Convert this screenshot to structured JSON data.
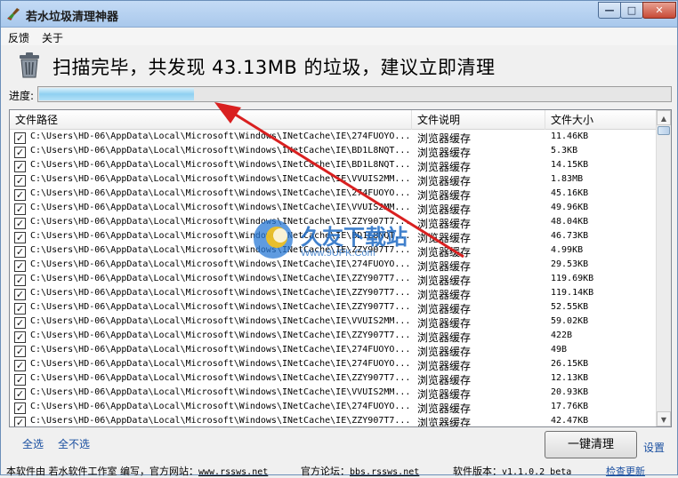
{
  "window": {
    "title": "若水垃圾清理神器",
    "controls": {
      "minimize": "—",
      "maximize": "□",
      "close": "✕"
    }
  },
  "menu": {
    "feedback": "反馈",
    "about": "关于"
  },
  "status": {
    "icon": "trash-can-icon",
    "text": "扫描完毕，共发现 43.13MB 的垃圾，建议立即清理"
  },
  "progress": {
    "label": "进度:",
    "fraction": 0.245
  },
  "table": {
    "columns": {
      "path": "文件路径",
      "description": "文件说明",
      "size": "文件大小"
    },
    "rows": [
      {
        "path": "C:\\Users\\HD-06\\AppData\\Local\\Microsoft\\Windows\\INetCache\\IE\\274FUOYO...",
        "desc": "浏览器缓存",
        "size": "11.46KB",
        "checked": true
      },
      {
        "path": "C:\\Users\\HD-06\\AppData\\Local\\Microsoft\\Windows\\INetCache\\IE\\BD1L8NQT...",
        "desc": "浏览器缓存",
        "size": "5.3KB",
        "checked": true
      },
      {
        "path": "C:\\Users\\HD-06\\AppData\\Local\\Microsoft\\Windows\\INetCache\\IE\\BD1L8NQT...",
        "desc": "浏览器缓存",
        "size": "14.15KB",
        "checked": true
      },
      {
        "path": "C:\\Users\\HD-06\\AppData\\Local\\Microsoft\\Windows\\INetCache\\IE\\VVUIS2MM...",
        "desc": "浏览器缓存",
        "size": "1.83MB",
        "checked": true
      },
      {
        "path": "C:\\Users\\HD-06\\AppData\\Local\\Microsoft\\Windows\\INetCache\\IE\\274FUOYO...",
        "desc": "浏览器缓存",
        "size": "45.16KB",
        "checked": true
      },
      {
        "path": "C:\\Users\\HD-06\\AppData\\Local\\Microsoft\\Windows\\INetCache\\IE\\VVUIS2MM...",
        "desc": "浏览器缓存",
        "size": "49.96KB",
        "checked": true
      },
      {
        "path": "C:\\Users\\HD-06\\AppData\\Local\\Microsoft\\Windows\\INetCache\\IE\\ZZY907T7...",
        "desc": "浏览器缓存",
        "size": "48.04KB",
        "checked": true
      },
      {
        "path": "C:\\Users\\HD-06\\AppData\\Local\\Microsoft\\Windows\\INetCache\\IE\\BD1L8NQT...",
        "desc": "浏览器缓存",
        "size": "46.73KB",
        "checked": true
      },
      {
        "path": "C:\\Users\\HD-06\\AppData\\Local\\Microsoft\\Windows\\INetCache\\IE\\ZZY907T7...",
        "desc": "浏览器缓存",
        "size": "4.99KB",
        "checked": true
      },
      {
        "path": "C:\\Users\\HD-06\\AppData\\Local\\Microsoft\\Windows\\INetCache\\IE\\274FUOYO...",
        "desc": "浏览器缓存",
        "size": "29.53KB",
        "checked": true
      },
      {
        "path": "C:\\Users\\HD-06\\AppData\\Local\\Microsoft\\Windows\\INetCache\\IE\\ZZY907T7...",
        "desc": "浏览器缓存",
        "size": "119.69KB",
        "checked": true
      },
      {
        "path": "C:\\Users\\HD-06\\AppData\\Local\\Microsoft\\Windows\\INetCache\\IE\\ZZY907T7...",
        "desc": "浏览器缓存",
        "size": "119.14KB",
        "checked": true
      },
      {
        "path": "C:\\Users\\HD-06\\AppData\\Local\\Microsoft\\Windows\\INetCache\\IE\\ZZY907T7...",
        "desc": "浏览器缓存",
        "size": "52.55KB",
        "checked": true
      },
      {
        "path": "C:\\Users\\HD-06\\AppData\\Local\\Microsoft\\Windows\\INetCache\\IE\\VVUIS2MM...",
        "desc": "浏览器缓存",
        "size": "59.02KB",
        "checked": true
      },
      {
        "path": "C:\\Users\\HD-06\\AppData\\Local\\Microsoft\\Windows\\INetCache\\IE\\ZZY907T7...",
        "desc": "浏览器缓存",
        "size": "422B",
        "checked": true
      },
      {
        "path": "C:\\Users\\HD-06\\AppData\\Local\\Microsoft\\Windows\\INetCache\\IE\\274FUOYO...",
        "desc": "浏览器缓存",
        "size": "49B",
        "checked": true
      },
      {
        "path": "C:\\Users\\HD-06\\AppData\\Local\\Microsoft\\Windows\\INetCache\\IE\\274FUOYO...",
        "desc": "浏览器缓存",
        "size": "26.15KB",
        "checked": true
      },
      {
        "path": "C:\\Users\\HD-06\\AppData\\Local\\Microsoft\\Windows\\INetCache\\IE\\ZZY907T7...",
        "desc": "浏览器缓存",
        "size": "12.13KB",
        "checked": true
      },
      {
        "path": "C:\\Users\\HD-06\\AppData\\Local\\Microsoft\\Windows\\INetCache\\IE\\VVUIS2MM...",
        "desc": "浏览器缓存",
        "size": "20.93KB",
        "checked": true
      },
      {
        "path": "C:\\Users\\HD-06\\AppData\\Local\\Microsoft\\Windows\\INetCache\\IE\\274FUOYO...",
        "desc": "浏览器缓存",
        "size": "17.76KB",
        "checked": true
      },
      {
        "path": "C:\\Users\\HD-06\\AppData\\Local\\Microsoft\\Windows\\INetCache\\IE\\ZZY907T7...",
        "desc": "浏览器缓存",
        "size": "42.47KB",
        "checked": true
      }
    ]
  },
  "actions": {
    "select_all": "全选",
    "select_none": "全不选",
    "clean_now": "一键清理",
    "settings": "设置"
  },
  "footer": {
    "site_prefix": "本软件由 若水软件工作室 编写，官方网站：",
    "site_url": "www.rssws.net",
    "forum_prefix": "官方论坛：",
    "forum_url": "bbs.rssws.net",
    "version_label": "软件版本：",
    "version": "v1.1.0.2 beta",
    "check_update": "检查更新"
  },
  "watermark": {
    "name": "久友下载站",
    "url": "Www.9UPK.Com"
  },
  "colors": {
    "accent": "#1a4fa0",
    "progress": "#8fd0f1",
    "arrow": "#d92020"
  }
}
